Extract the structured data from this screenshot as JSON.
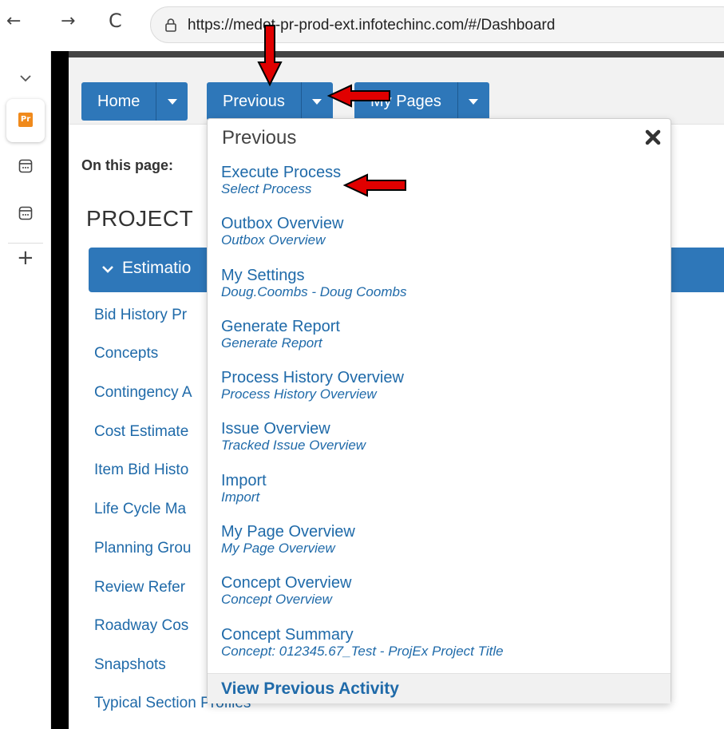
{
  "browser": {
    "url": "https://medot-pr-prod-ext.infotechinc.com/#/Dashboard",
    "back_glyph": "←",
    "forward_glyph": "→",
    "reload_glyph": "C"
  },
  "sidebar": {
    "app_badge": "Pr",
    "add_glyph": "+"
  },
  "header": {
    "buttons": [
      {
        "label": "Home"
      },
      {
        "label": "Previous"
      },
      {
        "label": "My Pages"
      }
    ]
  },
  "page": {
    "on_this_page": "On this page:",
    "heading": "PROJECT",
    "section": "Estimatio",
    "links": [
      "Bid History Pr",
      "Concepts",
      "Contingency A",
      "Cost Estimate",
      "Item Bid Histo",
      "Life Cycle Ma",
      "Planning Grou",
      "Review Refer",
      "Roadway Cos",
      "Snapshots",
      "Typical Section Profiles"
    ]
  },
  "dropdown": {
    "title": "Previous",
    "items": [
      {
        "title": "Execute Process",
        "subtitle": "Select Process"
      },
      {
        "title": "Outbox Overview",
        "subtitle": "Outbox Overview"
      },
      {
        "title": "My Settings",
        "subtitle": "Doug.Coombs - Doug Coombs"
      },
      {
        "title": "Generate Report",
        "subtitle": "Generate Report"
      },
      {
        "title": "Process History Overview",
        "subtitle": "Process History Overview"
      },
      {
        "title": "Issue Overview",
        "subtitle": "Tracked Issue Overview"
      },
      {
        "title": "Import",
        "subtitle": "Import"
      },
      {
        "title": "My Page Overview",
        "subtitle": "My Page Overview"
      },
      {
        "title": "Concept Overview",
        "subtitle": "Concept Overview"
      },
      {
        "title": "Concept Summary",
        "subtitle": "Concept: 012345.67_Test - ProjEx Project Title"
      }
    ],
    "footer": "View Previous Activity"
  },
  "colors": {
    "primary_blue": "#2e77b9",
    "link_blue": "#1f6aa9",
    "annotation_red": "#e00000",
    "badge_orange": "#f08a1c"
  }
}
